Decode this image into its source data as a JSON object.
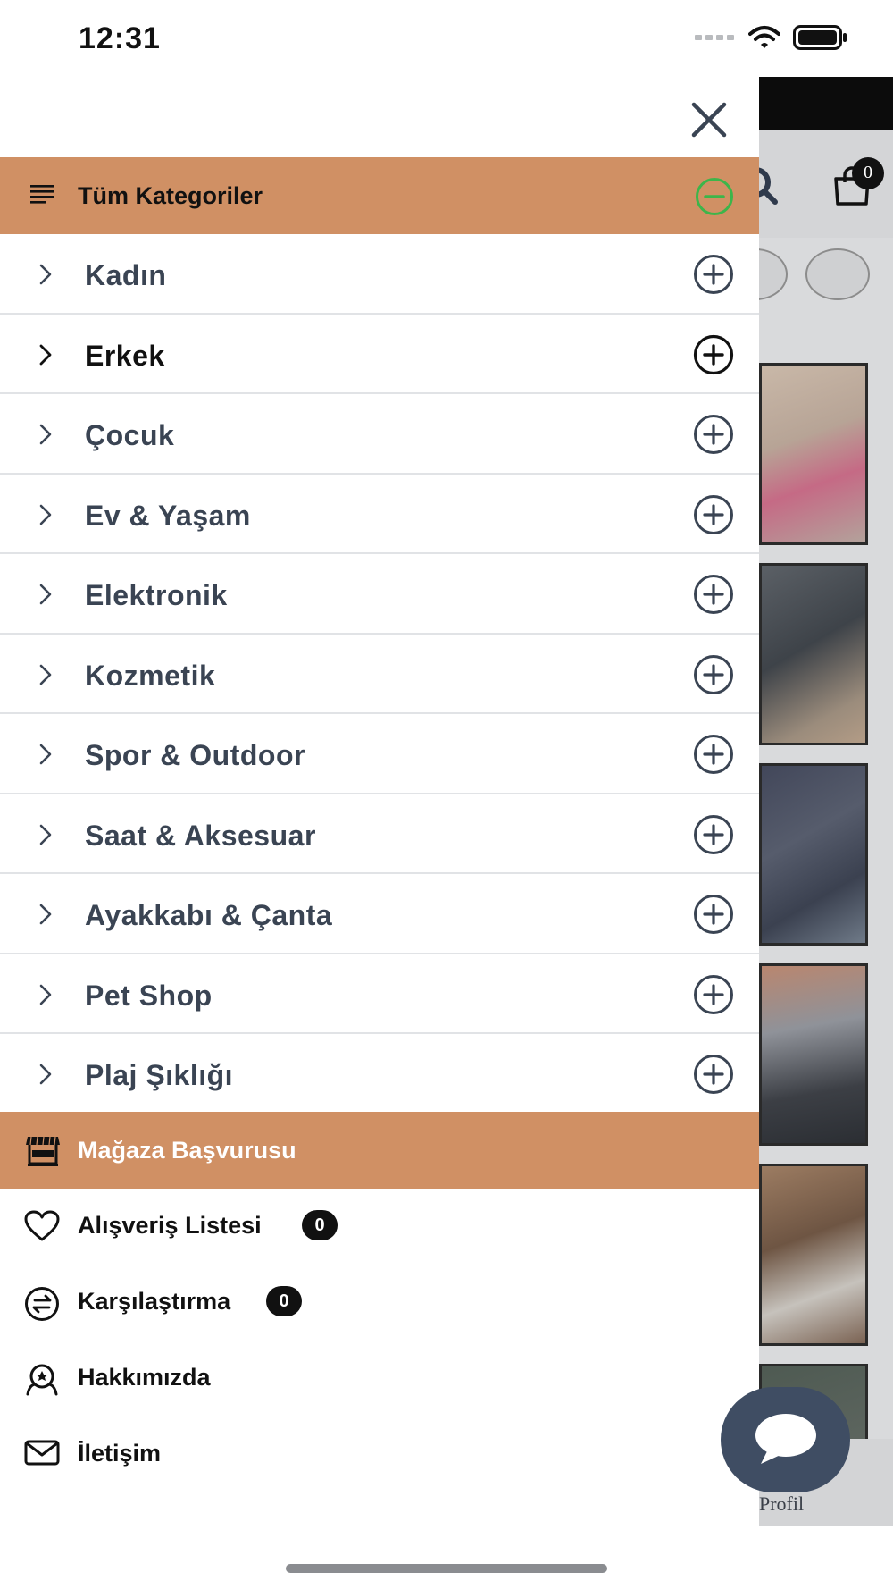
{
  "status_bar": {
    "time": "12:31"
  },
  "background_app": {
    "cart_count": "0",
    "bottom_tab_label": "Profil"
  },
  "drawer": {
    "all_categories_label": "Tüm Kategoriler",
    "categories": [
      {
        "label": "Kadın"
      },
      {
        "label": "Erkek"
      },
      {
        "label": "Çocuk"
      },
      {
        "label": "Ev & Yaşam"
      },
      {
        "label": "Elektronik"
      },
      {
        "label": "Kozmetik"
      },
      {
        "label": "Spor & Outdoor"
      },
      {
        "label": "Saat & Aksesuar"
      },
      {
        "label": "Ayakkabı & Çanta"
      },
      {
        "label": "Pet Shop"
      },
      {
        "label": "Plaj Şıklığı"
      }
    ],
    "store_application_label": "Mağaza Başvurusu",
    "links": {
      "wishlist": {
        "label": "Alışveriş Listesi",
        "count": "0"
      },
      "compare": {
        "label": "Karşılaştırma",
        "count": "0"
      },
      "about": {
        "label": "Hakkımızda"
      },
      "contact": {
        "label": "İletişim"
      }
    }
  },
  "colors": {
    "accent": "#d09064",
    "collapse_icon": "#3db54a",
    "text_primary": "#3a4453",
    "chat_button": "#3f4d63"
  },
  "icons": [
    "menu-lines-icon",
    "collapse-minus-icon",
    "expand-plus-icon",
    "chevron-right-icon",
    "close-icon",
    "shop-icon",
    "heart-icon",
    "compare-arrows-icon",
    "about-badge-icon",
    "mail-icon",
    "chat-bubble-icon",
    "cart-icon",
    "search-icon",
    "wifi-icon",
    "battery-icon",
    "signal-icon"
  ]
}
